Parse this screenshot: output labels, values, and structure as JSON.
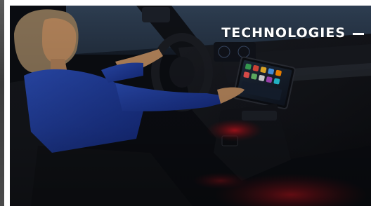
{
  "section": {
    "title": "TECHNOLOGIES"
  },
  "image": {
    "subject": "car-interior-touchscreen-photo",
    "icon": "dash-icon"
  },
  "colors": {
    "title_text": "#ffffff",
    "card_bg": "#0b0d12",
    "sleeve_blue": "#1e3a8a",
    "ambient_red": "#b3121b"
  }
}
